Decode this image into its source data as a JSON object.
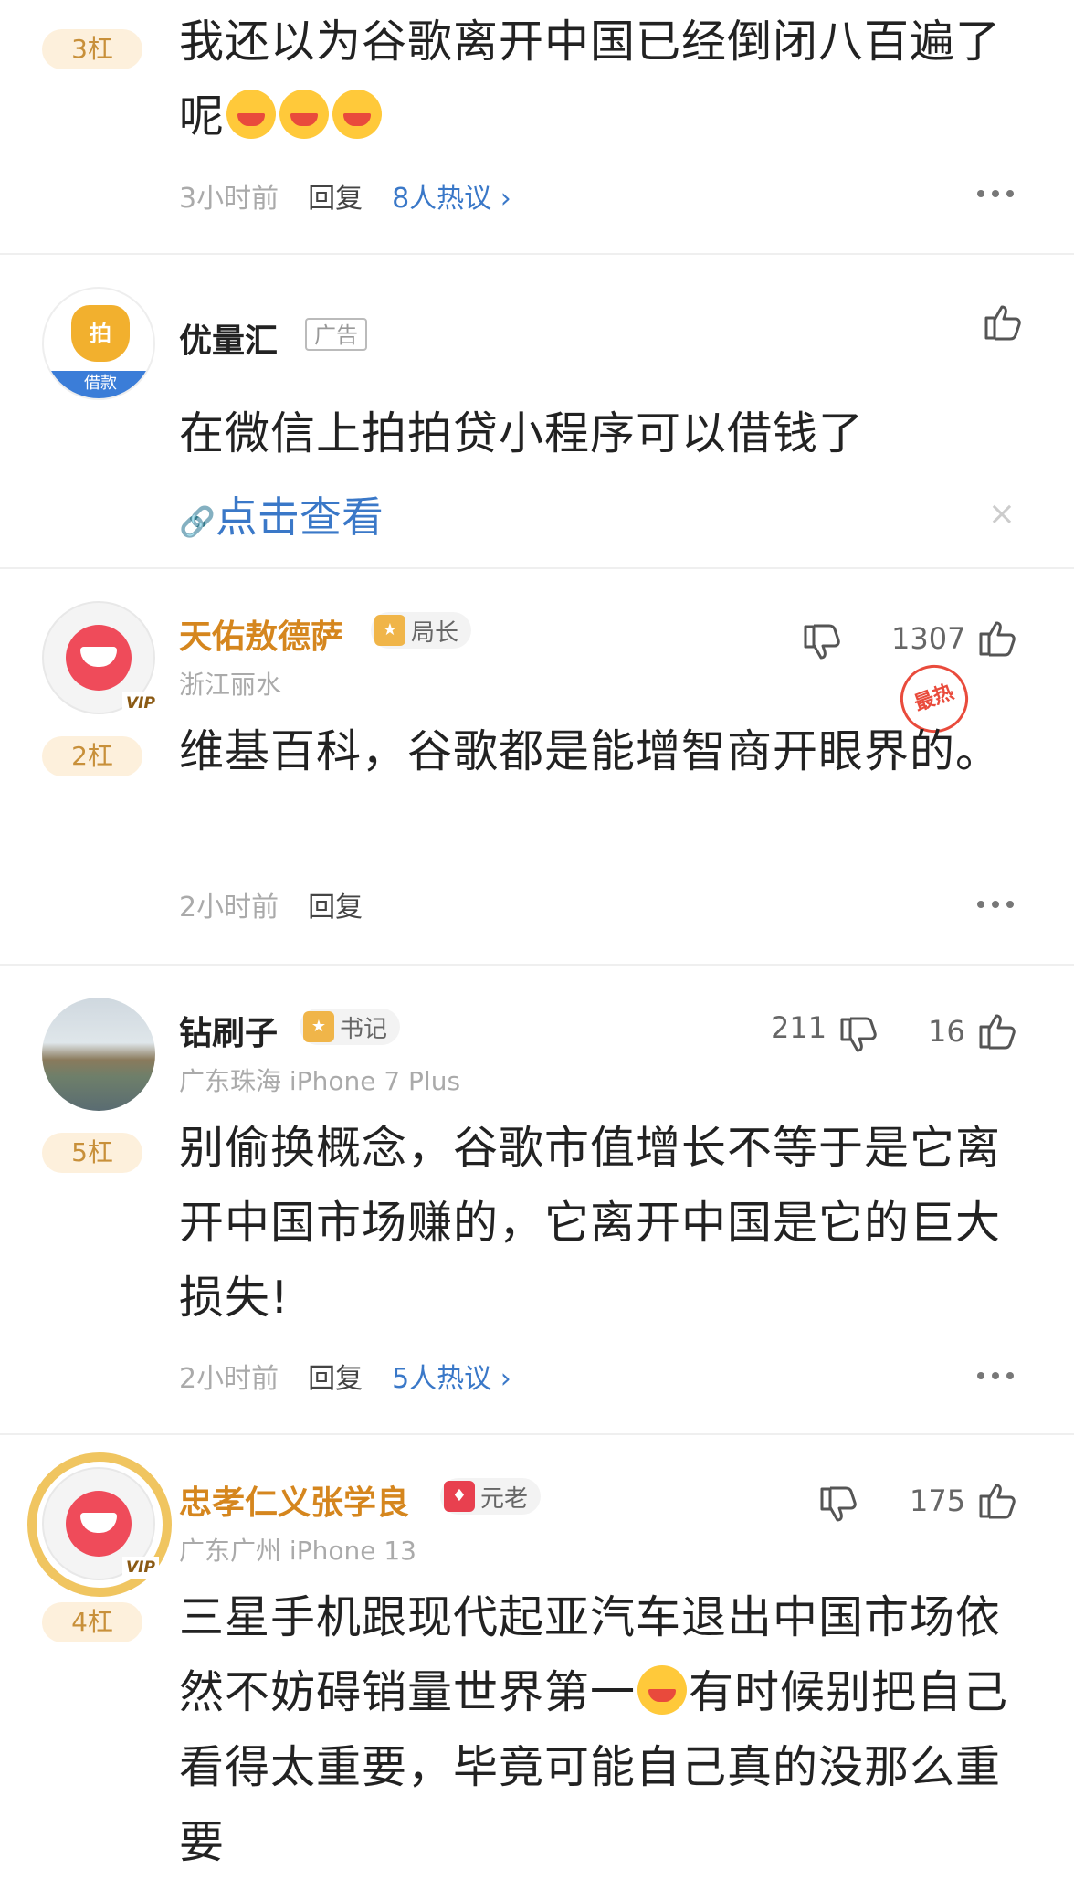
{
  "comments": [
    {
      "floor": "3杠",
      "text_a": "我还以为谷歌离开中国已经倒闭八百遍了呢",
      "emoji": "laughing-emoji",
      "time": "3小时前",
      "reply": "回复",
      "hot": "8人热议",
      "hot_arrow": "›"
    },
    {
      "name": "天佑敖德萨",
      "badge": "局长",
      "location": "浙江丽水",
      "likes": "1307",
      "hot_stamp": "最热",
      "vip": "VIP",
      "floor": "2杠",
      "text": "维基百科，谷歌都是能增智商开眼界的。",
      "time": "2小时前",
      "reply": "回复"
    },
    {
      "name": "钻刷子",
      "badge": "书记",
      "location": "广东珠海",
      "device": "iPhone 7 Plus",
      "dislikes": "211",
      "likes": "16",
      "floor": "5杠",
      "text": "别偷换概念，谷歌市值增长不等于是它离开中国市场赚的，它离开中国是它的巨大损失!",
      "time": "2小时前",
      "reply": "回复",
      "hot": "5人热议",
      "hot_arrow": "›"
    },
    {
      "name": "忠孝仁义张学良",
      "badge": "元老",
      "location": "广东广州",
      "device": "iPhone 13",
      "likes": "175",
      "vip": "VIP",
      "floor": "4杠",
      "text_a": "三星手机跟现代起亚汽车退出中国市场依然不妨碍销量世界第一",
      "text_b": "有时候别把自己看得太重要，毕竟可能自己真的没那么重要"
    }
  ],
  "ad": {
    "name": "优量汇",
    "tag": "广告",
    "logo_text": "拍",
    "logo_strip": "借款",
    "text": "在微信上拍拍贷小程序可以借钱了",
    "link": "点击查看",
    "close": "×"
  },
  "colors": {
    "accent_gold": "#d5861e",
    "link_blue": "#3a78c8",
    "hot_red": "#e94b3c"
  }
}
